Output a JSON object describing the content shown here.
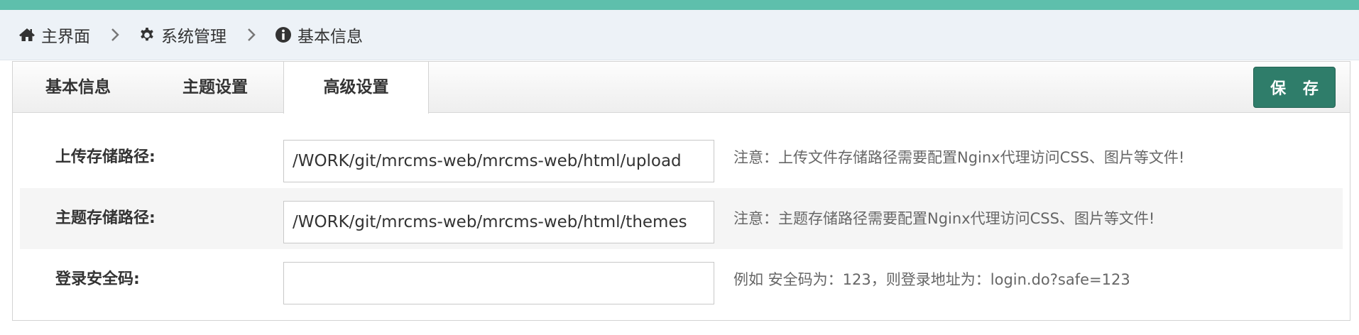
{
  "breadcrumb": {
    "items": [
      {
        "label": "主界面",
        "icon": "home-icon"
      },
      {
        "label": "系统管理",
        "icon": "gear-icon"
      },
      {
        "label": "基本信息",
        "icon": "info-circle-icon"
      }
    ]
  },
  "tabs": [
    {
      "label": "基本信息",
      "active": false
    },
    {
      "label": "主题设置",
      "active": false
    },
    {
      "label": "高级设置",
      "active": true
    }
  ],
  "toolbar": {
    "save_label": "保 存"
  },
  "form": {
    "rows": [
      {
        "label": "上传存储路径:",
        "value": "/WORK/git/mrcms-web/mrcms-web/html/upload",
        "note": "注意：上传文件存储路径需要配置Nginx代理访问CSS、图片等文件!"
      },
      {
        "label": "主题存储路径:",
        "value": "/WORK/git/mrcms-web/mrcms-web/html/themes",
        "note": "注意：主题存储路径需要配置Nginx代理访问CSS、图片等文件!"
      },
      {
        "label": "登录安全码:",
        "value": "",
        "note": "例如 安全码为：123，则登录地址为：login.do?safe=123"
      }
    ]
  },
  "colors": {
    "top_bar": "#5ebfac",
    "save_button": "#2f7d6a",
    "breadcrumb_bg": "#edf2f7"
  }
}
